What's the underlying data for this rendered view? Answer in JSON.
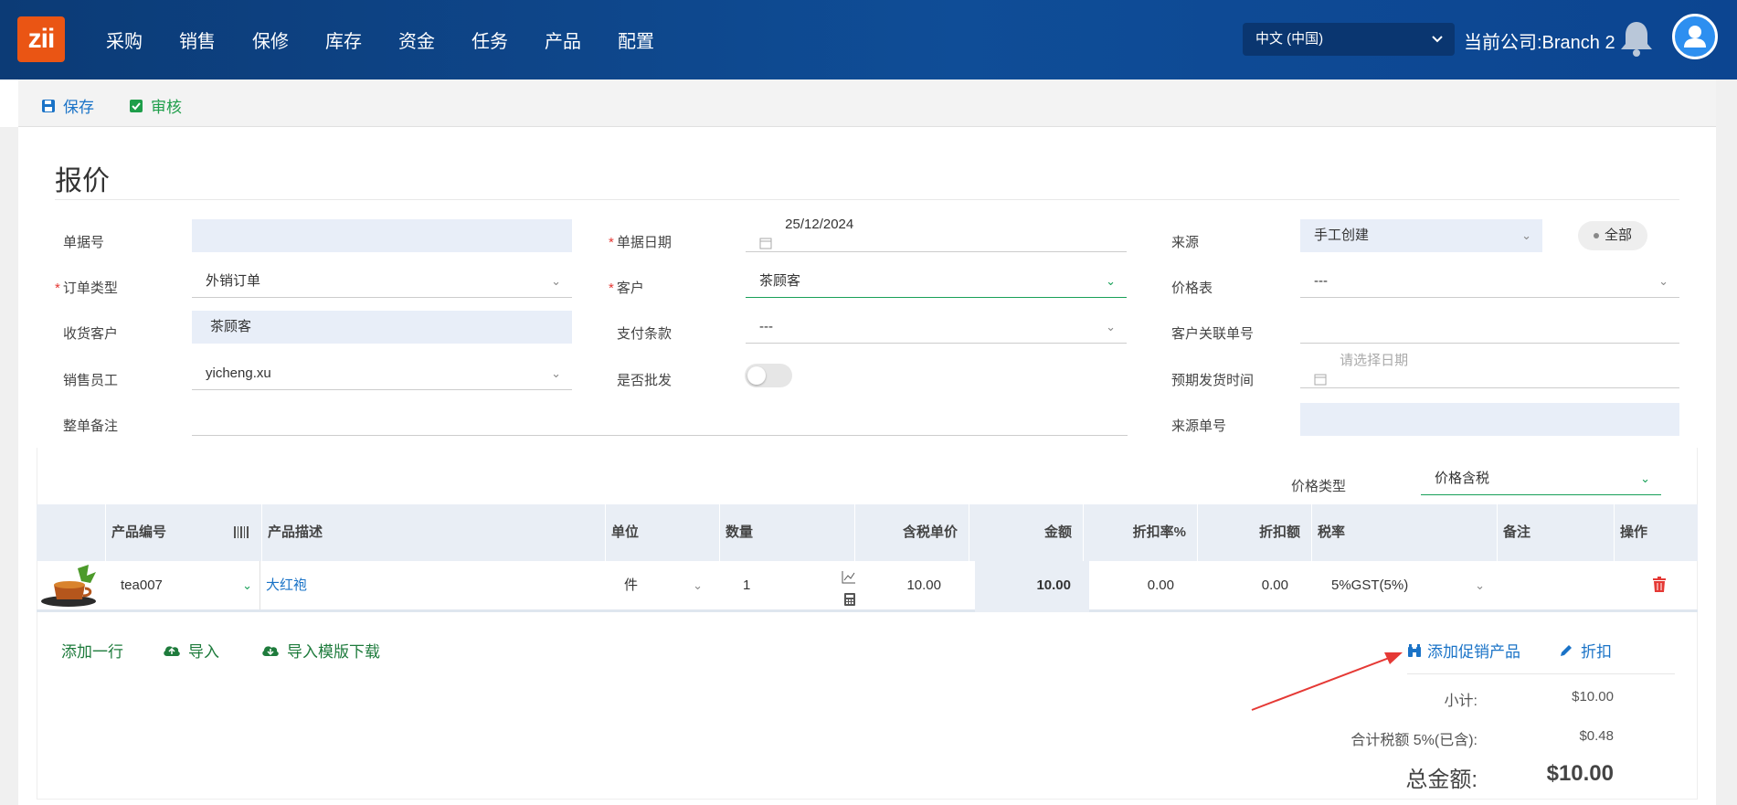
{
  "app": {
    "logo_text": "zii",
    "logo_color": "#ea5514"
  },
  "nav": [
    "采购",
    "销售",
    "保修",
    "库存",
    "资金",
    "任务",
    "产品",
    "配置"
  ],
  "header": {
    "language": "中文 (中国)",
    "company": "当前公司:Branch 2"
  },
  "toolbar": {
    "save_label": "保存",
    "audit_label": "审核"
  },
  "page": {
    "title": "报价"
  },
  "form": {
    "doc_no": {
      "label": "单据号",
      "value": ""
    },
    "order_type": {
      "label": "订单类型",
      "value": "外销订单"
    },
    "ship_customer": {
      "label": "收货客户",
      "value": "茶顾客"
    },
    "salesperson": {
      "label": "销售员工",
      "value": "yicheng.xu"
    },
    "remark": {
      "label": "整单备注",
      "value": ""
    },
    "doc_date": {
      "label": "单据日期",
      "value": "25/12/2024"
    },
    "customer": {
      "label": "客户",
      "value": "茶顾客"
    },
    "payment_terms": {
      "label": "支付条款",
      "value": "---"
    },
    "wholesale": {
      "label": "是否批发",
      "value": false
    },
    "source": {
      "label": "来源",
      "value": "手工创建",
      "pill": "全部"
    },
    "price_list": {
      "label": "价格表",
      "value": "---"
    },
    "customer_ref": {
      "label": "客户关联单号",
      "value": ""
    },
    "expected_ship": {
      "label": "预期发货时间",
      "placeholder": "请选择日期"
    },
    "source_no": {
      "label": "来源单号",
      "value": ""
    }
  },
  "price_type": {
    "label": "价格类型",
    "value": "价格含税"
  },
  "table": {
    "headers": {
      "code": "产品编号",
      "desc": "产品描述",
      "unit": "单位",
      "qty": "数量",
      "price": "含税单价",
      "amount": "金额",
      "disc_rate": "折扣率%",
      "disc_amt": "折扣额",
      "tax": "税率",
      "note": "备注",
      "op": "操作"
    },
    "rows": [
      {
        "code": "tea007",
        "desc": "大红袍",
        "unit": "件",
        "qty": "1",
        "price": "10.00",
        "amount": "10.00",
        "disc_rate": "0.00",
        "disc_amt": "0.00",
        "tax": "5%GST(5%)",
        "note": ""
      }
    ]
  },
  "actions": {
    "add_row": "添加一行",
    "import": "导入",
    "download_template": "导入模版下载",
    "add_promo": "添加促销产品",
    "discount": "折扣"
  },
  "totals": {
    "subtotal_label": "小计:",
    "subtotal": "$10.00",
    "tax_label": "合计税额 5%(已含):",
    "tax": "$0.48",
    "total_label": "总金额:",
    "total": "$10.00"
  },
  "colors": {
    "accent_blue": "#1a73c7",
    "accent_green": "#18a058",
    "nav_bg": "#0f4d97",
    "annotation_arrow": "#e53935"
  }
}
